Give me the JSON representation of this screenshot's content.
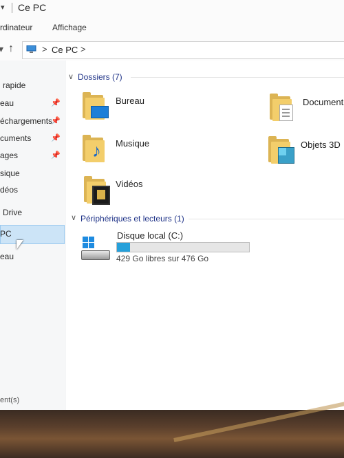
{
  "window": {
    "title": "Ce PC",
    "quick_access_arrow": "▾"
  },
  "ribbon": {
    "tabs": [
      "rdinateur",
      "Affichage"
    ]
  },
  "address": {
    "path": "Ce PC",
    "chevron": ">"
  },
  "sidebar": {
    "items": [
      {
        "label": "rapide",
        "pinned": false
      },
      {
        "label": "eau",
        "pinned": true
      },
      {
        "label": "échargements",
        "pinned": true
      },
      {
        "label": "cuments",
        "pinned": true
      },
      {
        "label": "ages",
        "pinned": true
      },
      {
        "label": "sique",
        "pinned": false
      },
      {
        "label": "déos",
        "pinned": false
      },
      {
        "label": "Drive",
        "pinned": false
      },
      {
        "label": "PC",
        "pinned": false,
        "selected": true
      },
      {
        "label": "eau",
        "pinned": false
      }
    ],
    "status": "ent(s)"
  },
  "content": {
    "folders_header": "Dossiers (7)",
    "folders": [
      {
        "label": "Bureau",
        "icon": "desktop-folder-icon"
      },
      {
        "label": "Documents",
        "icon": "documents-folder-icon"
      },
      {
        "label": "Musique",
        "icon": "music-folder-icon"
      },
      {
        "label": "Objets 3D",
        "icon": "3d-objects-folder-icon"
      },
      {
        "label": "Vidéos",
        "icon": "videos-folder-icon"
      }
    ],
    "devices_header": "Périphériques et lecteurs (1)",
    "drive": {
      "label": "Disque local (C:)",
      "free_text": "429 Go libres sur 476 Go",
      "used_fraction": 0.099,
      "icon": "windows-drive-icon"
    }
  },
  "colors": {
    "accent": "#26a0da",
    "header": "#1e3287",
    "selection": "#cce4f7"
  }
}
